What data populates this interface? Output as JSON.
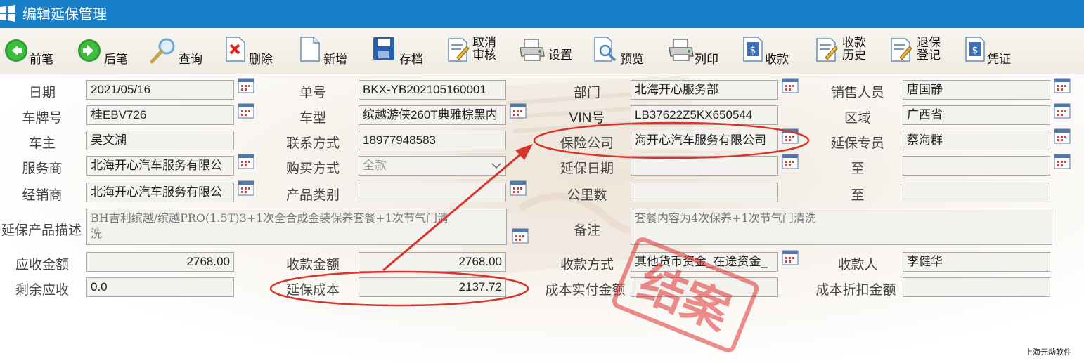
{
  "window": {
    "title": "编辑延保管理"
  },
  "toolbar": {
    "prev": "前笔",
    "next": "后笔",
    "query": "查询",
    "delete": "删除",
    "new": "新增",
    "save": "存档",
    "cancel_review_1": "取消",
    "cancel_review_2": "审核",
    "settings": "设置",
    "preview": "预览",
    "print": "列印",
    "collect": "收款",
    "collect_history_1": "收款",
    "collect_history_2": "历史",
    "refund_register_1": "退保",
    "refund_register_2": "登记",
    "voucher": "凭证"
  },
  "form": {
    "date": {
      "label": "日期",
      "value": "2021/05/16"
    },
    "order_no": {
      "label": "单号",
      "value": "BKX-YB202105160001"
    },
    "department": {
      "label": "部门",
      "value": "北海开心服务部"
    },
    "salesperson": {
      "label": "销售人员",
      "value": "唐国静"
    },
    "plate": {
      "label": "车牌号",
      "value": "桂EBV726"
    },
    "model": {
      "label": "车型",
      "value": "缤越游侠260T典雅棕黑内"
    },
    "vin": {
      "label": "VIN号",
      "value": "LB37622Z5KX650544"
    },
    "region": {
      "label": "区域",
      "value": "广西省"
    },
    "owner": {
      "label": "车主",
      "value": "吴文湖"
    },
    "contact": {
      "label": "联系方式",
      "value": "18977948583"
    },
    "insurer": {
      "label": "保险公司",
      "value": "海开心汽车服务有限公司"
    },
    "specialist": {
      "label": "延保专员",
      "value": "蔡海群"
    },
    "service_provider": {
      "label": "服务商",
      "value": "北海开心汽车服务有限公"
    },
    "purchase_method": {
      "label": "购买方式",
      "value": "全款"
    },
    "warranty_date": {
      "label": "延保日期",
      "value": ""
    },
    "to1": {
      "label": "至",
      "value": ""
    },
    "dealer": {
      "label": "经销商",
      "value": "北海开心汽车服务有限公"
    },
    "product_category": {
      "label": "产品类别",
      "value": ""
    },
    "mileage": {
      "label": "公里数",
      "value": ""
    },
    "to2": {
      "label": "至",
      "value": ""
    },
    "product_desc": {
      "label": "延保产品描述",
      "value_line1": "BH吉利缤越/缤越PRO(1.5T)3+1次全合成金装保养套餐+1次节气门清",
      "value_line2": "洗"
    },
    "remark": {
      "label": "备注",
      "value": "套餐内容为4次保养+1次节气门清洗"
    },
    "receivable": {
      "label": "应收金额",
      "value": "2768.00"
    },
    "received": {
      "label": "收款金额",
      "value": "2768.00"
    },
    "pay_method": {
      "label": "收款方式",
      "value": "其他货币资金_在途资金_"
    },
    "receiver": {
      "label": "收款人",
      "value": "李健华"
    },
    "remaining": {
      "label": "剩余应收",
      "value": "0.0"
    },
    "warranty_cost": {
      "label": "延保成本",
      "value": "2137.72"
    },
    "cost_paid": {
      "label": "成本实付金额",
      "value": ""
    },
    "cost_discount": {
      "label": "成本折扣金额",
      "value": ""
    }
  },
  "stamp": {
    "text": "结案"
  },
  "footer": {
    "vendor": "上海元动软件"
  },
  "colors": {
    "titlebar": "#1a7fc9",
    "annotation_red": "#d9342b"
  }
}
